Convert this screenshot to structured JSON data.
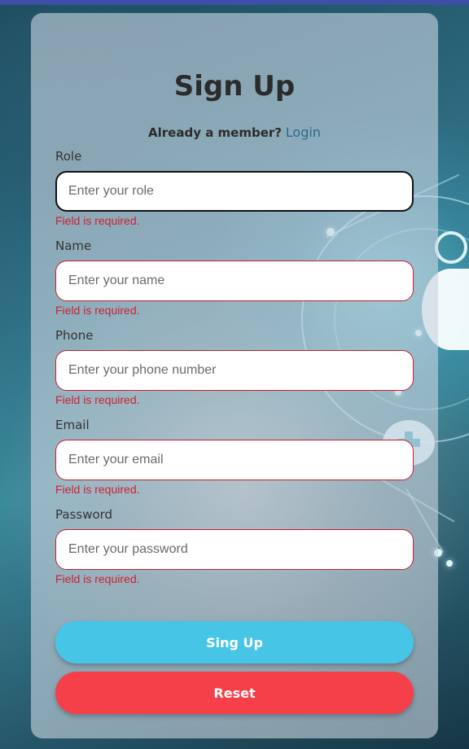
{
  "theme": {
    "accent_primary": "#46c5e6",
    "accent_danger": "#f5404a",
    "link_color": "#2c6b8c",
    "error_color": "#d0202f"
  },
  "form": {
    "title": "Sign Up",
    "member_prompt": "Already a member?",
    "login_link": "Login",
    "fields": [
      {
        "label": "Role",
        "placeholder": "Enter your role",
        "value": "",
        "error": "Field is required.",
        "focused": true
      },
      {
        "label": "Name",
        "placeholder": "Enter your name",
        "value": "",
        "error": "Field is required."
      },
      {
        "label": "Phone",
        "placeholder": "Enter your phone number",
        "value": "",
        "error": "Field is required."
      },
      {
        "label": "Email",
        "placeholder": "Enter your email",
        "value": "",
        "error": "Field is required."
      },
      {
        "label": "Password",
        "placeholder": "Enter your password",
        "value": "",
        "error": "Field is required."
      }
    ],
    "submit_label": "Sing Up",
    "reset_label": "Reset"
  }
}
